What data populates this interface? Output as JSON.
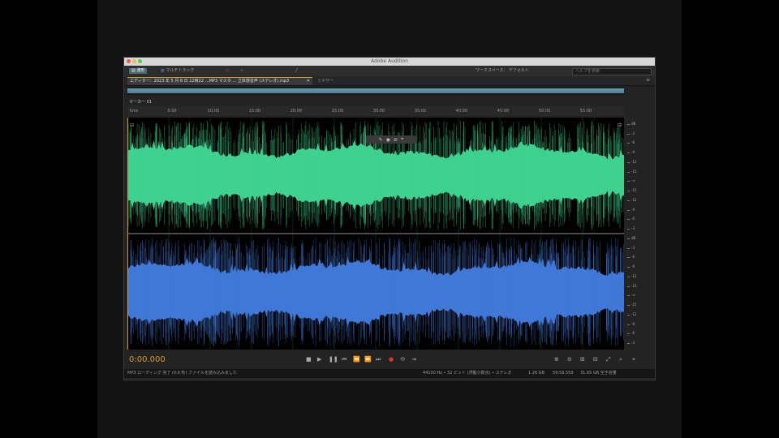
{
  "app": {
    "title": "Adobe Audition",
    "traffic_lights": [
      "#ec5f57",
      "#f5be4f",
      "#5fc454"
    ]
  },
  "toolbar": {
    "waveform_label": "波形",
    "multitrack_label": "マルチトラック",
    "workspace_label": "ワークスペース：",
    "workspace_value": "デフォルト",
    "search_placeholder": "ヘルプを検索"
  },
  "document": {
    "tab_label": "エディター：2023 年 5 月 8 日 12時22 …MP3 マスタ … 立体感音声 (ステレオ).mp3",
    "mixer_label": "ミキサー",
    "marker_label": "マーカー 01"
  },
  "ruler": {
    "ticks": [
      "hms",
      "5:00",
      "10:00",
      "15:00",
      "20:00",
      "25:00",
      "30:00",
      "35:00",
      "40:00",
      "45:00",
      "50:00",
      "55:00"
    ]
  },
  "waveform": {
    "left_channel_color": "#3fd18f",
    "right_channel_color": "#4178d7",
    "selection_color": "#d39a25"
  },
  "transport": {
    "timecode": "0:00.000",
    "buttons": [
      "stop-icon",
      "play-icon",
      "pause-icon",
      "rewind-start-icon",
      "rewind-icon",
      "forward-icon",
      "forward-end-icon",
      "record-icon",
      "loop-icon",
      "skip-icon"
    ]
  },
  "status": {
    "left": "MP3 ローディング 完了 (0.0 秒) ファイルを読み込みました",
    "sample_info": "44100 Hz • 32 ビット (浮動小数点) • ステレオ",
    "size": "1.26 GB",
    "duration": "59:59.559",
    "free_space": "31.65 GB 空き容量"
  },
  "scale": {
    "labels": [
      "dB",
      "-3",
      "-6",
      "-9",
      "-12",
      "-15",
      "-∞",
      "-15",
      "-12",
      "-9",
      "-6",
      "-3",
      "dB",
      "-3",
      "-6",
      "-9",
      "-12",
      "-15",
      "-∞",
      "-15",
      "-12",
      "-9",
      "-6",
      "-3"
    ]
  }
}
